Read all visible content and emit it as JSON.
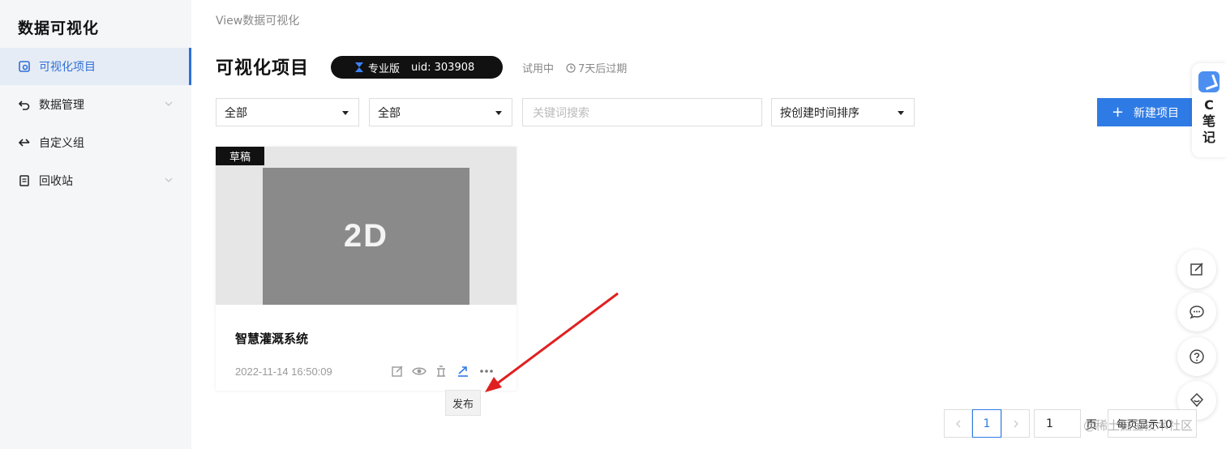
{
  "sidebar": {
    "brand": "数据可视化",
    "items": [
      {
        "label": "可视化项目",
        "icon": "dashboard-icon",
        "active": true
      },
      {
        "label": "数据管理",
        "icon": "undo-arrow-icon",
        "has_submenu": true
      },
      {
        "label": "自定义组",
        "icon": "merge-arrows-icon"
      },
      {
        "label": "回收站",
        "icon": "document-icon",
        "has_submenu": true
      }
    ]
  },
  "header": {
    "breadcrumb": "View数据可视化",
    "title": "可视化项目",
    "badge": {
      "icon": "hourglass-icon",
      "label": "专业版",
      "uid": "uid: 303908"
    },
    "trial": "试用中",
    "expire": "7天后过期"
  },
  "filters": {
    "filter1": "全部",
    "filter2": "全部",
    "search_placeholder": "关键词搜索",
    "sort": "按创建时间排序",
    "new_button": "新建项目"
  },
  "project": {
    "status": "草稿",
    "thumbnail_text": "2D",
    "name": "智慧灌溉系统",
    "date": "2022-11-14 16:50:09",
    "actions": [
      "edit-icon",
      "preview-eye-icon",
      "copy-icon",
      "publish-arrow-icon",
      "more-icon"
    ],
    "tooltip": "发布"
  },
  "floating": {
    "cnote_text": "C笔记",
    "buttons": [
      "edit-note-icon",
      "comment-icon",
      "help-icon",
      "support-icon"
    ]
  },
  "pagination": {
    "current_page": "1",
    "jump_value": "1",
    "page_unit": "页",
    "page_size": "每页显示10"
  },
  "watermark": "@稀土掘金技术社区",
  "colors": {
    "accent": "#2f7be5",
    "sidebar_active": "#2f6fd6",
    "annotation_arrow": "#e02020"
  }
}
